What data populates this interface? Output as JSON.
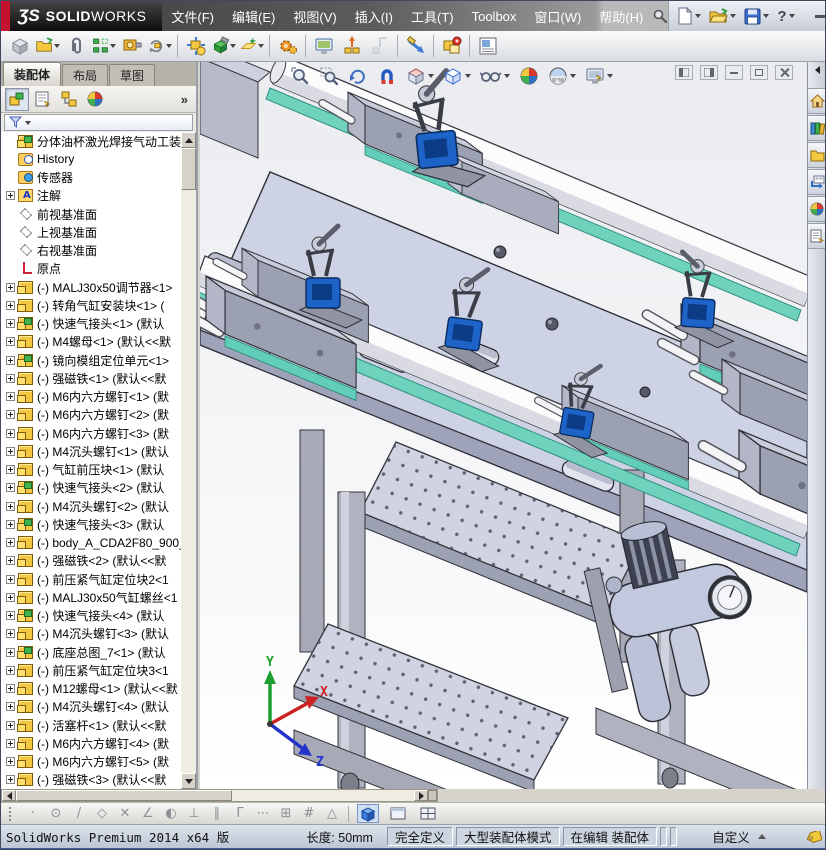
{
  "titlebar": {
    "logo_prefix": "ƷS",
    "logo_solid": "SOLID",
    "logo_works": "WORKS",
    "menus": [
      "文件(F)",
      "编辑(E)",
      "视图(V)",
      "插入(I)",
      "工具(T)",
      "Toolbox",
      "窗口(W)",
      "帮助(H)"
    ],
    "help_glyph": "?"
  },
  "tabs": {
    "items": [
      {
        "label": "装配体",
        "active": true
      },
      {
        "label": "布局"
      },
      {
        "label": "草图"
      }
    ]
  },
  "panel": {
    "more_glyph": "»"
  },
  "tree": {
    "root": "分体油杯激光焊接气动工装",
    "items": [
      {
        "icon": "history",
        "label": "History"
      },
      {
        "icon": "sensors",
        "label": "传感器"
      },
      {
        "icon": "ann",
        "label": "注解",
        "expand": true
      },
      {
        "icon": "plane",
        "label": "前视基准面"
      },
      {
        "icon": "plane",
        "label": "上视基准面"
      },
      {
        "icon": "plane",
        "label": "右视基准面"
      },
      {
        "icon": "origin",
        "label": "原点"
      },
      {
        "icon": "part",
        "label": "(-) MALJ30x50调节器<1>",
        "expand": true
      },
      {
        "icon": "part",
        "label": "(-) 转角气缸安装块<1> (",
        "expand": true
      },
      {
        "icon": "subasm",
        "label": "(-) 快速气接头<1> (默认",
        "expand": true
      },
      {
        "icon": "part",
        "label": "(-) M4螺母<1> (默认<<默",
        "expand": true
      },
      {
        "icon": "subasm",
        "label": "(-) 镜向模组定位单元<1>",
        "expand": true
      },
      {
        "icon": "part",
        "label": "(-) 强磁铁<1> (默认<<默",
        "expand": true
      },
      {
        "icon": "part",
        "label": "(-) M6内六方螺钉<1> (默",
        "expand": true
      },
      {
        "icon": "part",
        "label": "(-) M6内六方螺钉<2> (默",
        "expand": true
      },
      {
        "icon": "part",
        "label": "(-) M6内六方螺钉<3> (默",
        "expand": true
      },
      {
        "icon": "part",
        "label": "(-) M4沉头螺钉<1> (默认",
        "expand": true
      },
      {
        "icon": "part",
        "label": "(-) 气缸前压块<1> (默认",
        "expand": true
      },
      {
        "icon": "subasm",
        "label": "(-) 快速气接头<2> (默认",
        "expand": true
      },
      {
        "icon": "part",
        "label": "(-) M4沉头螺钉<2> (默认",
        "expand": true
      },
      {
        "icon": "subasm",
        "label": "(-) 快速气接头<3> (默认",
        "expand": true
      },
      {
        "icon": "part",
        "label": "(-) body_A_CDA2F80_900_",
        "expand": true
      },
      {
        "icon": "part",
        "label": "(-) 强磁铁<2> (默认<<默",
        "expand": true
      },
      {
        "icon": "part",
        "label": "(-) 前压紧气缸定位块2<1",
        "expand": true
      },
      {
        "icon": "part",
        "label": "(-) MALJ30x50气缸螺丝<1",
        "expand": true
      },
      {
        "icon": "subasm",
        "label": "(-) 快速气接头<4> (默认",
        "expand": true
      },
      {
        "icon": "part",
        "label": "(-) M4沉头螺钉<3> (默认",
        "expand": true
      },
      {
        "icon": "subasm",
        "label": "(-) 底座总图_7<1> (默认",
        "expand": true
      },
      {
        "icon": "part",
        "label": "(-) 前压紧气缸定位块3<1",
        "expand": true
      },
      {
        "icon": "part",
        "label": "(-) M12螺母<1> (默认<<默",
        "expand": true
      },
      {
        "icon": "part",
        "label": "(-) M4沉头螺钉<4> (默认",
        "expand": true
      },
      {
        "icon": "part",
        "label": "(-) 活塞杆<1> (默认<<默",
        "expand": true
      },
      {
        "icon": "part",
        "label": "(-) M6内六方螺钉<4> (默",
        "expand": true
      },
      {
        "icon": "part",
        "label": "(-) M6内六方螺钉<5> (默",
        "expand": true
      },
      {
        "icon": "part",
        "label": "(-) 强磁铁<3> (默认<<默",
        "expand": true
      }
    ]
  },
  "viewport": {
    "triad": {
      "x": "X",
      "y": "Y",
      "z": "Z"
    },
    "triad_colors": {
      "x": "#cc2222",
      "y": "#1d9e30",
      "z": "#2233cc"
    }
  },
  "icons": {
    "assembly_toolbar": [
      "insert-component",
      "insert-from-file",
      "mate",
      "linear-component-pattern",
      "smart-fasteners",
      "rotate-component",
      "move-component",
      "assembly-features",
      "reference-geometry",
      "motion-study",
      "assembly-visualization",
      "exploded-view",
      "explode-line-sketch",
      "measure",
      "interference-detection",
      "bill-of-materials"
    ],
    "headsup": [
      "zoom-fit",
      "zoom-area",
      "previous-view",
      "section-view",
      "view-orientation",
      "display-style",
      "hide-show-items",
      "edit-appearance",
      "apply-scene",
      "view-settings"
    ],
    "taskpane": [
      "solidworks-resources",
      "design-library",
      "file-explorer",
      "view-palette",
      "appearances-scenes",
      "custom-properties"
    ],
    "quickbar_glyphs": [
      "·",
      "⊙",
      "/",
      "◇",
      "✕",
      "∠",
      "◐",
      "⊥",
      "∥",
      "Γ",
      "⋯",
      "⊞",
      "#",
      "△"
    ]
  },
  "statusbar": {
    "app": "SolidWorks Premium 2014 x64 版",
    "length": "长度: 50mm",
    "defined": "完全定义",
    "mode": "大型装配体模式",
    "editing": "在编辑 装配体",
    "custom": "自定义"
  },
  "colors": {
    "accent_red": "#c41230",
    "plate": "#cdd2e4",
    "teal": "#6ed2bd",
    "clamp_blue": "#1e63c8",
    "status_bar_blue": "#3e5e9e"
  }
}
